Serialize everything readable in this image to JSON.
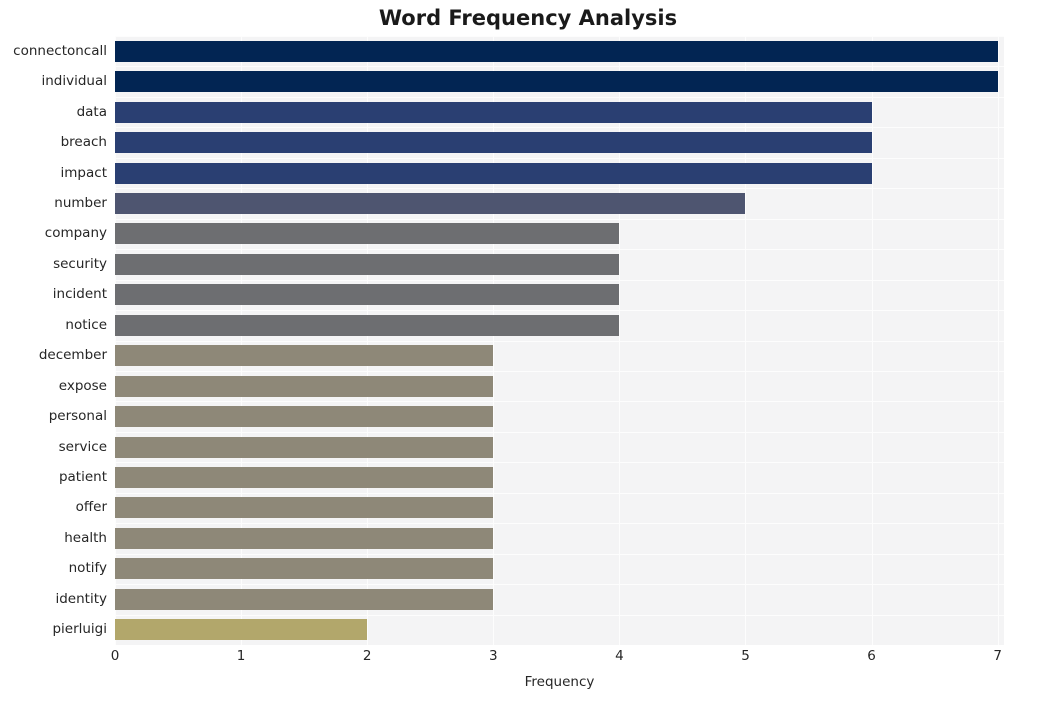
{
  "chart_data": {
    "type": "bar",
    "orientation": "horizontal",
    "title": "Word Frequency Analysis",
    "xlabel": "Frequency",
    "ylabel": "",
    "categories": [
      "connectoncall",
      "individual",
      "data",
      "breach",
      "impact",
      "number",
      "company",
      "security",
      "incident",
      "notice",
      "december",
      "expose",
      "personal",
      "service",
      "patient",
      "offer",
      "health",
      "notify",
      "identity",
      "pierluigi"
    ],
    "values": [
      7,
      7,
      6,
      6,
      6,
      5,
      4,
      4,
      4,
      4,
      3,
      3,
      3,
      3,
      3,
      3,
      3,
      3,
      3,
      2
    ],
    "bar_colors": [
      "#022553",
      "#022553",
      "#2a3f72",
      "#2a3f72",
      "#2a3f72",
      "#4e5570",
      "#6d6e71",
      "#6d6e71",
      "#6d6e71",
      "#6d6e71",
      "#8e8878",
      "#8e8878",
      "#8e8878",
      "#8e8878",
      "#8e8878",
      "#8e8878",
      "#8e8878",
      "#8e8878",
      "#8e8878",
      "#b2a76b"
    ],
    "xlim": [
      0,
      7.05
    ],
    "xticks": [
      0,
      1,
      2,
      3,
      4,
      5,
      6,
      7
    ],
    "xtick_labels": [
      "0",
      "1",
      "2",
      "3",
      "4",
      "5",
      "6",
      "7"
    ],
    "grid": true,
    "grid_color": "#fdfdfd",
    "plot_background": "#f4f4f5",
    "figure_background": "#ffffff",
    "legend": null
  }
}
